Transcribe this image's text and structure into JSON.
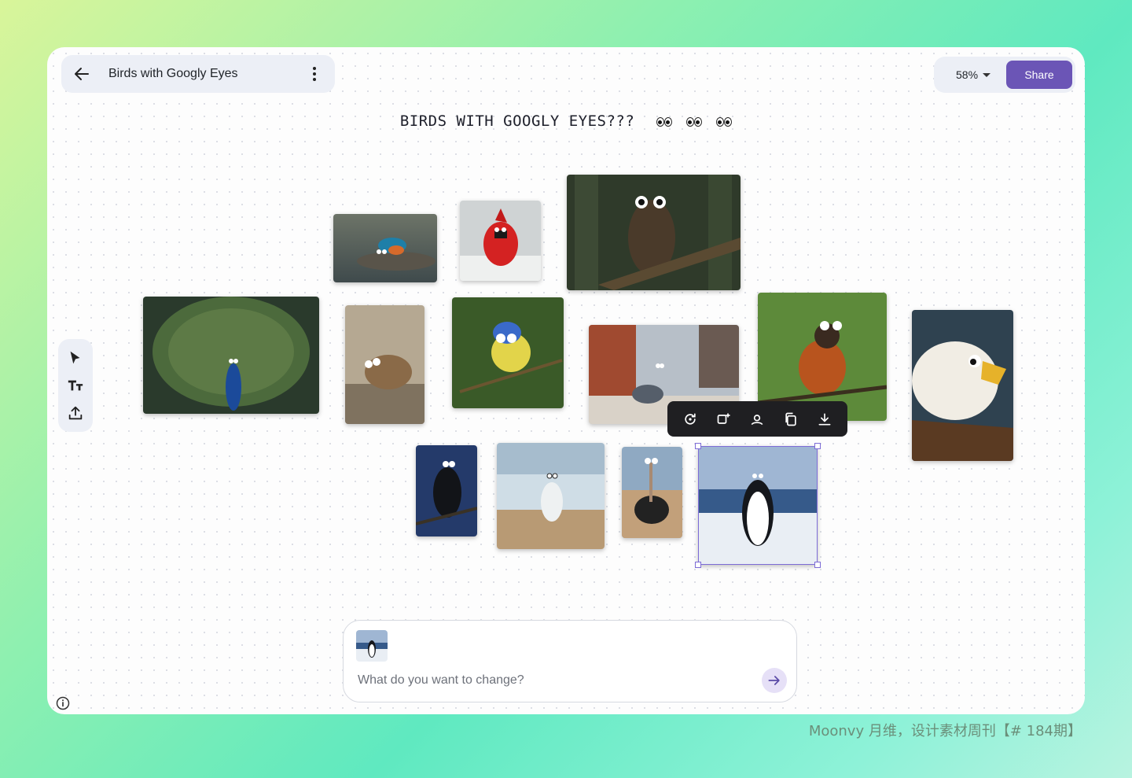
{
  "header": {
    "board_name": "Birds with Googly Eyes",
    "zoom_label": "58%",
    "share_label": "Share"
  },
  "board": {
    "title": "BIRDS WITH GOOGLY EYES???"
  },
  "tools": [
    "select-tool",
    "text-tool",
    "upload-tool"
  ],
  "image_toolbar": [
    "regenerate",
    "remix",
    "edit-subject",
    "duplicate",
    "download"
  ],
  "photos": [
    "kingfisher",
    "cardinal",
    "owl",
    "peacock",
    "sparrow",
    "blue-tit",
    "pigeon",
    "robin",
    "eagle",
    "crow",
    "seagull",
    "ostrich",
    "penguin"
  ],
  "prompt": {
    "placeholder": "What do you want to change?"
  },
  "watermark": "Moonvy 月维，设计素材周刊【# 184期】",
  "colors": {
    "accent": "#6b55b6",
    "selection": "#7d6cd6",
    "pill_bg": "#eceff6"
  }
}
